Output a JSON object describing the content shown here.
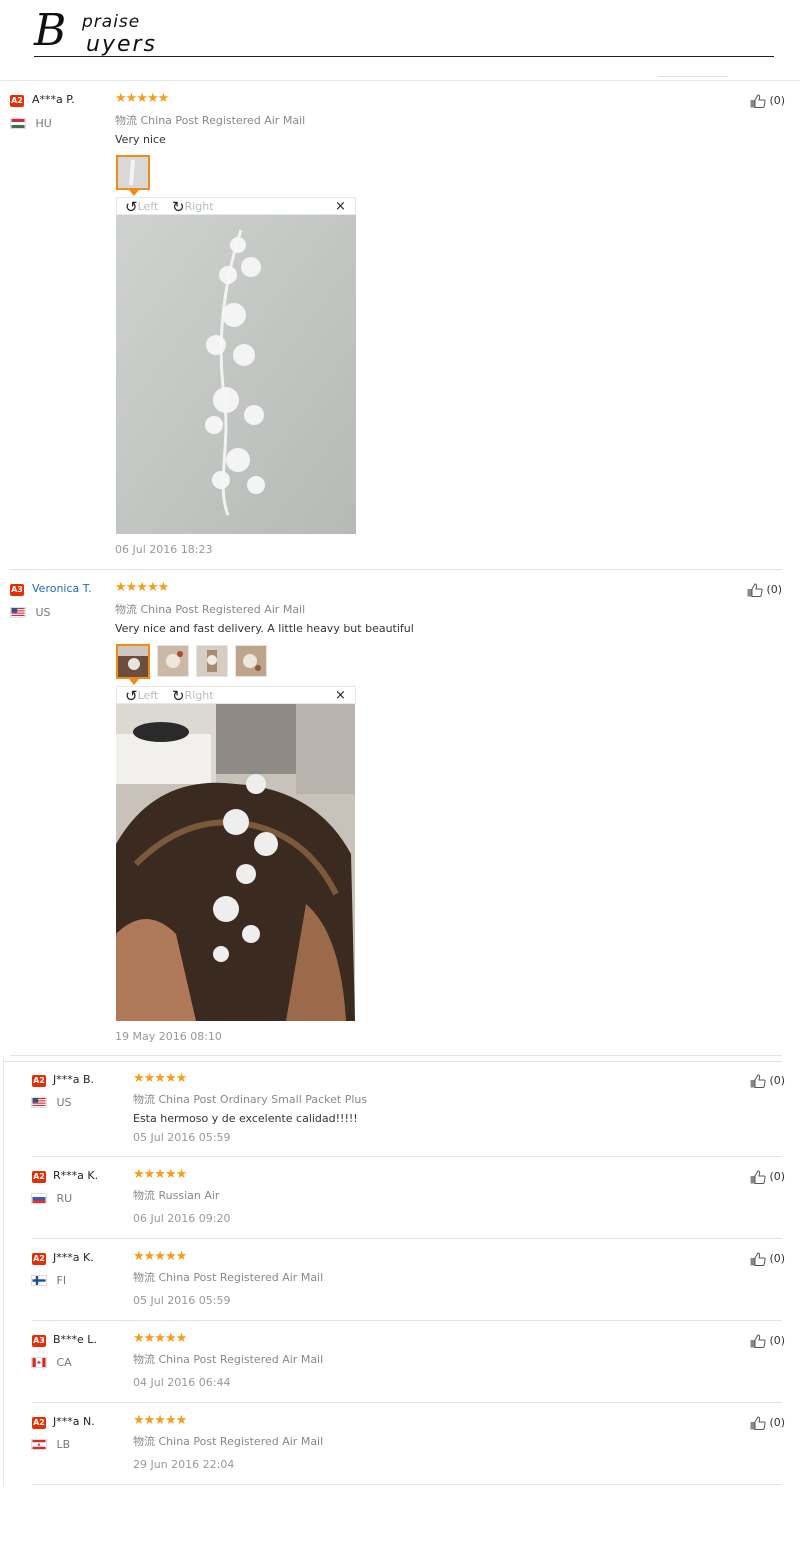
{
  "header": {
    "logo_b": "B",
    "logo_praise": "praise",
    "logo_uyers": "uyers"
  },
  "viewer": {
    "left_label": "Left",
    "right_label": "Right",
    "close": "×"
  },
  "ship_label": "物流",
  "reviews": [
    {
      "badge": "A2",
      "name": "A***a P.",
      "country": "HU",
      "stars": "★★★★★",
      "shipping": "China Post Registered Air Mail",
      "text": "Very nice",
      "date": "06 Jul 2016 18:23",
      "likes": "(0)"
    },
    {
      "badge": "A3",
      "name": "Veronica T.",
      "country": "US",
      "stars": "★★★★★",
      "shipping": "China Post Registered Air Mail",
      "text": "Very nice and fast delivery. A little heavy but beautiful",
      "date": "19 May 2016 08:10",
      "likes": "(0)"
    },
    {
      "badge": "A2",
      "name": "J***a B.",
      "country": "US",
      "stars": "★★★★★",
      "shipping": "China Post Ordinary Small Packet Plus",
      "text": "Esta hermoso y de excelente calidad!!!!!",
      "date": "05 Jul 2016 05:59",
      "likes": "(0)"
    },
    {
      "badge": "A2",
      "name": "R***a K.",
      "country": "RU",
      "stars": "★★★★★",
      "shipping": "Russian Air",
      "text": "",
      "date": "06 Jul 2016 09:20",
      "likes": "(0)"
    },
    {
      "badge": "A2",
      "name": "J***a K.",
      "country": "FI",
      "stars": "★★★★★",
      "shipping": "China Post Registered Air Mail",
      "text": "",
      "date": "05 Jul 2016 05:59",
      "likes": "(0)"
    },
    {
      "badge": "A3",
      "name": "B***e L.",
      "country": "CA",
      "stars": "★★★★★",
      "shipping": "China Post Registered Air Mail",
      "text": "",
      "date": "04 Jul 2016 06:44",
      "likes": "(0)"
    },
    {
      "badge": "A2",
      "name": "J***a N.",
      "country": "LB",
      "stars": "★★★★★",
      "shipping": "China Post Registered Air Mail",
      "text": "",
      "date": "29 Jun 2016 22:04",
      "likes": "(0)"
    }
  ],
  "colors": {
    "accent_orange": "#f08c1d",
    "star": "#f59c1a",
    "badge_red": "#e62e04",
    "name_blue": "#1a6cc0"
  }
}
